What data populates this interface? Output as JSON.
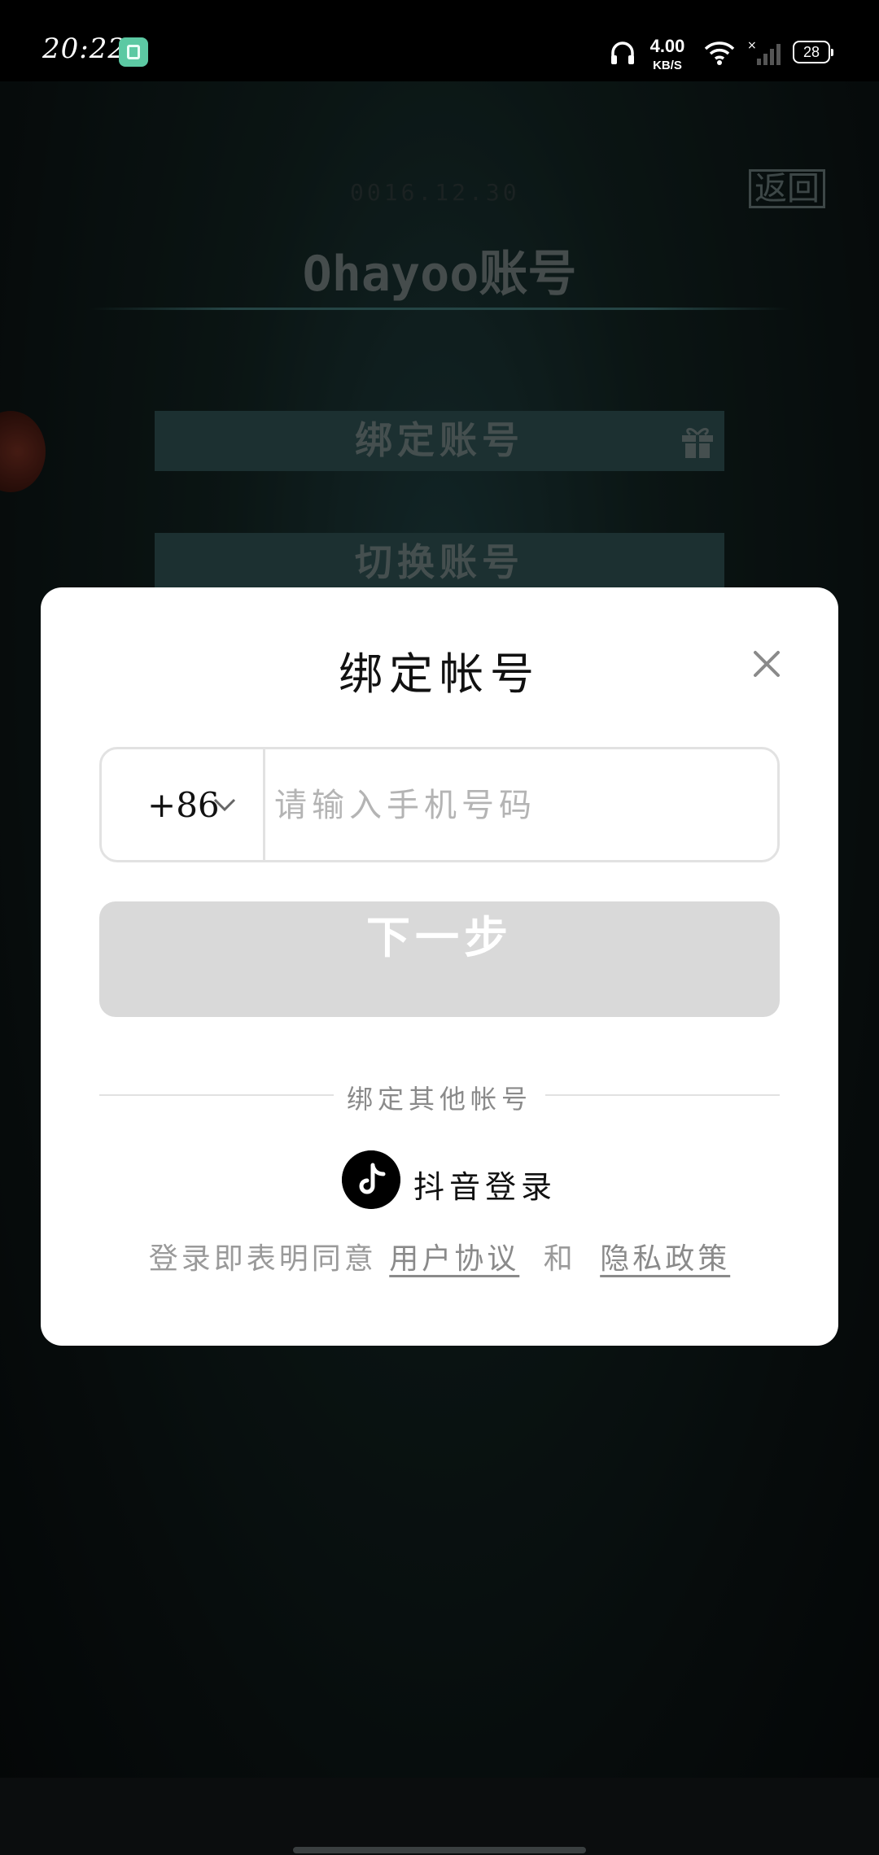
{
  "status_bar": {
    "time": "20:22",
    "net_speed_value": "4.00",
    "net_speed_unit": "KB/S",
    "battery": "28"
  },
  "game": {
    "date": "0016.12.30",
    "back_label": "返回",
    "title": "Ohayoo账号",
    "bind_button_label": "绑定账号",
    "switch_button_label": "切换账号"
  },
  "dialog": {
    "title": "绑定帐号",
    "country_code": "+86",
    "phone_placeholder": "请输入手机号码",
    "next_label": "下一步",
    "other_accounts_label": "绑定其他帐号",
    "douyin_label": "抖音登录",
    "agreement_prefix": "登录即表明同意",
    "user_agreement": "用户协议",
    "agreement_and": "和",
    "privacy_policy": "隐私政策"
  },
  "colors": {
    "accent_game_button": "#2c4a4c",
    "next_button_disabled": "#d9d9d9",
    "dialog_background": "#ffffff"
  }
}
